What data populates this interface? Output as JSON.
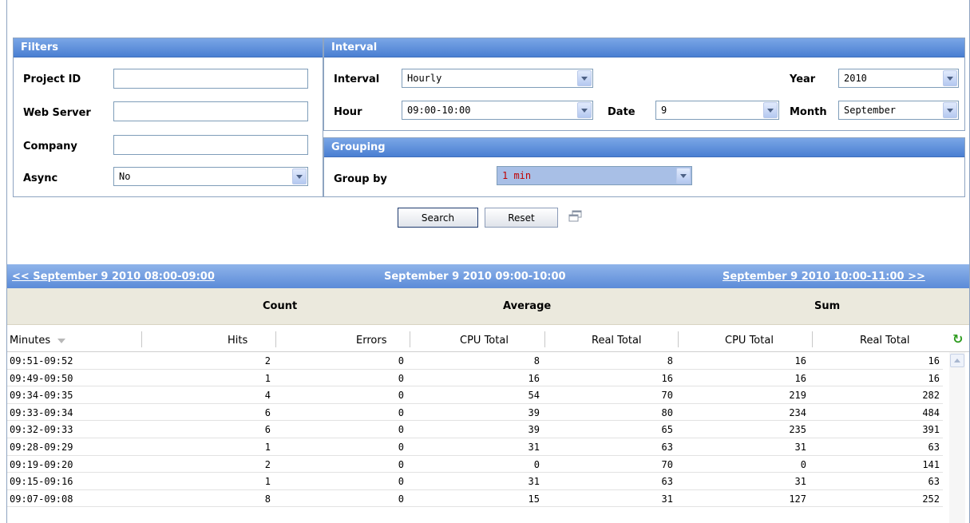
{
  "filters": {
    "title": "Filters",
    "project_id": {
      "label": "Project ID",
      "value": ""
    },
    "web_server": {
      "label": "Web Server",
      "value": ""
    },
    "company": {
      "label": "Company",
      "value": ""
    },
    "async": {
      "label": "Async",
      "value": "No"
    }
  },
  "interval": {
    "title": "Interval",
    "interval": {
      "label": "Interval",
      "value": "Hourly"
    },
    "year": {
      "label": "Year",
      "value": "2010"
    },
    "hour": {
      "label": "Hour",
      "value": "09:00-10:00"
    },
    "date": {
      "label": "Date",
      "value": "9"
    },
    "month": {
      "label": "Month",
      "value": "September"
    }
  },
  "grouping": {
    "title": "Grouping",
    "group_by": {
      "label": "Group by",
      "value": "1 min"
    }
  },
  "actions": {
    "search": "Search",
    "reset": "Reset"
  },
  "nav": {
    "prev": "<< September 9 2010 08:00-09:00",
    "current": "September 9 2010 09:00-10:00",
    "next": "September 9 2010 10:00-11:00 >>"
  },
  "groups": {
    "count": "Count",
    "average": "Average",
    "sum": "Sum"
  },
  "columns": [
    "Minutes",
    "Hits",
    "Errors",
    "CPU Total",
    "Real Total",
    "CPU Total",
    "Real Total"
  ],
  "rows": [
    [
      "09:51-09:52",
      "2",
      "0",
      "8",
      "8",
      "16",
      "16"
    ],
    [
      "09:49-09:50",
      "1",
      "0",
      "16",
      "16",
      "16",
      "16"
    ],
    [
      "09:34-09:35",
      "4",
      "0",
      "54",
      "70",
      "219",
      "282"
    ],
    [
      "09:33-09:34",
      "6",
      "0",
      "39",
      "80",
      "234",
      "484"
    ],
    [
      "09:32-09:33",
      "6",
      "0",
      "39",
      "65",
      "235",
      "391"
    ],
    [
      "09:28-09:29",
      "1",
      "0",
      "31",
      "63",
      "31",
      "63"
    ],
    [
      "09:19-09:20",
      "2",
      "0",
      "0",
      "70",
      "0",
      "141"
    ],
    [
      "09:15-09:16",
      "1",
      "0",
      "31",
      "63",
      "31",
      "63"
    ],
    [
      "09:07-09:08",
      "8",
      "0",
      "15",
      "31",
      "127",
      "252"
    ]
  ],
  "colors": {
    "header_blue": "#4a7fd2",
    "group_value_red": "#c00000",
    "refresh_green": "#2e9c1f"
  }
}
